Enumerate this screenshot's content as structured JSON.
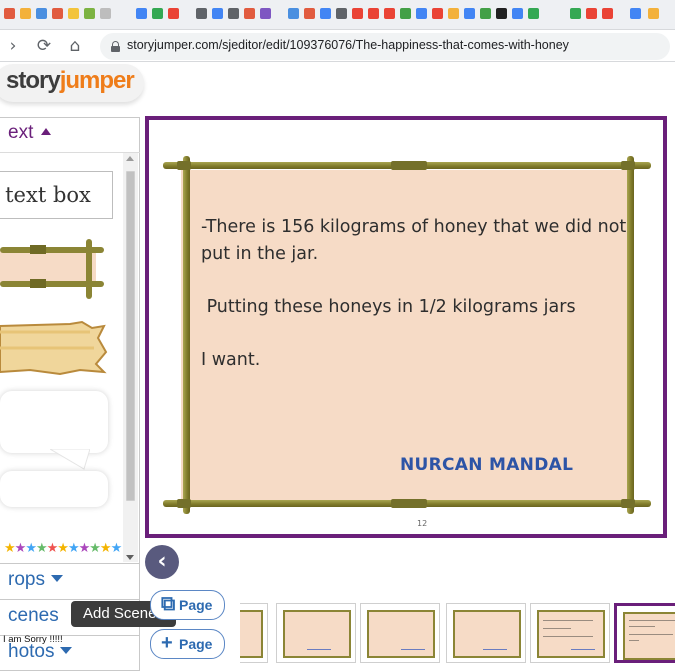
{
  "browser": {
    "url": "storyjumper.com/sjeditor/edit/109376076/The-happiness-that-comes-with-honey",
    "back_icon": "arrow-left-icon",
    "reload_icon": "reload-icon",
    "home_icon": "home-icon"
  },
  "app": {
    "logo_story": "story",
    "logo_jumper": "jumper"
  },
  "sidebar": {
    "text_section": "ext",
    "textbox_label": "g text box",
    "props_section": "rops",
    "scenes_section": "cenes",
    "photos_section": "hotos"
  },
  "tooltip": "Add Scenes",
  "overlay_text": "I am Sorry !!!!!",
  "page": {
    "paragraphs": [
      "-There is 156 kilograms of honey that we did not put in the jar.",
      " Putting these honeys in 1/2 kilograms jars",
      "I want."
    ],
    "author": "NURCAN MANDAL",
    "number": "12"
  },
  "controls": {
    "copy_page_label": "Page",
    "add_page_label": "Page"
  },
  "colors": {
    "frame": "#6a1f7a",
    "parchment": "#f6dbc6",
    "author": "#2d54a6",
    "section_link": "#2d6ab0"
  }
}
